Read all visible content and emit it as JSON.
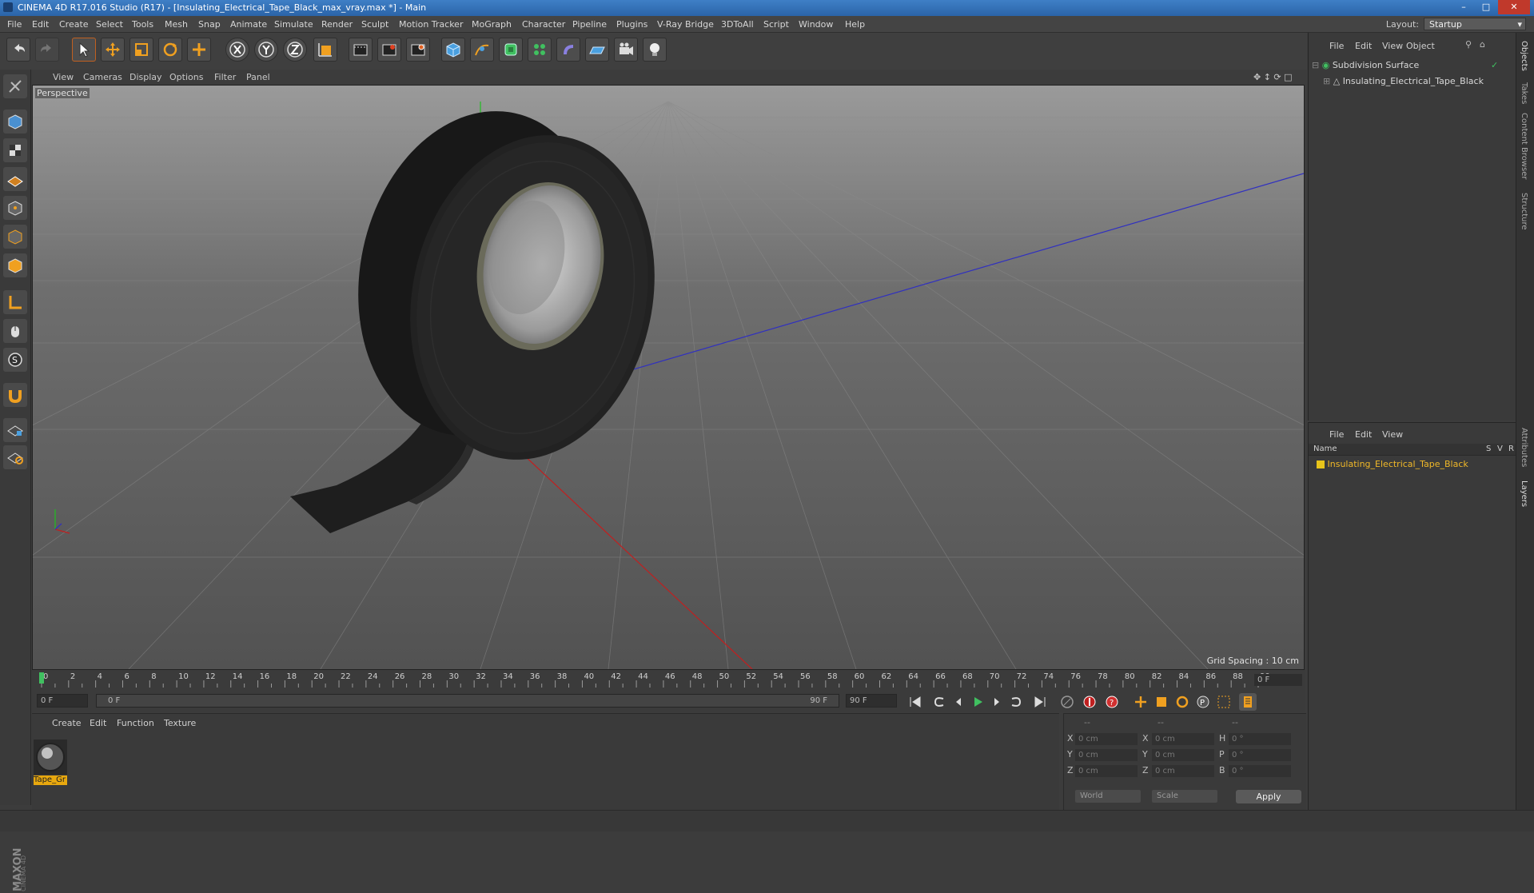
{
  "window": {
    "title": "CINEMA 4D R17.016 Studio (R17) - [Insulating_Electrical_Tape_Black_max_vray.max *] - Main"
  },
  "menu": [
    "File",
    "Edit",
    "Create",
    "Select",
    "Tools",
    "Mesh",
    "Snap",
    "Animate",
    "Simulate",
    "Render",
    "Sculpt",
    "Motion Tracker",
    "MoGraph",
    "Character",
    "Pipeline",
    "Plugins",
    "V-Ray Bridge",
    "3DToAll",
    "Script",
    "Window",
    "Help"
  ],
  "layout": {
    "label": "Layout:",
    "value": "Startup"
  },
  "toolbar": {
    "icons": [
      "undo-icon",
      "redo-icon",
      "select-arrow-icon",
      "move-icon",
      "scale-icon",
      "rotate-icon",
      "last-tool-icon",
      "x-axis-icon",
      "y-axis-icon",
      "z-axis-icon",
      "world-coord-icon",
      "render-view-icon",
      "render-picture-viewer-icon",
      "render-settings-icon",
      "cube-primitive-icon",
      "spline-pen-icon",
      "subdivision-icon",
      "mograph-cloner-icon",
      "deformer-icon",
      "floor-icon",
      "camera-icon",
      "light-icon"
    ]
  },
  "viewport": {
    "menu": [
      "View",
      "Cameras",
      "Display",
      "Options",
      "Filter",
      "Panel"
    ],
    "label": "Perspective",
    "grid_spacing": "Grid Spacing : 10 cm"
  },
  "timeline": {
    "ticks": [
      "0",
      "2",
      "4",
      "6",
      "8",
      "10",
      "12",
      "14",
      "16",
      "18",
      "20",
      "22",
      "24",
      "26",
      "28",
      "30",
      "32",
      "34",
      "36",
      "38",
      "40",
      "42",
      "44",
      "46",
      "48",
      "50",
      "52",
      "54",
      "56",
      "58",
      "60",
      "62",
      "64",
      "66",
      "68",
      "70",
      "72",
      "74",
      "76",
      "78",
      "80",
      "82",
      "84",
      "86",
      "88",
      "90"
    ],
    "current_frame": "0 F",
    "start_field": "0 F",
    "range_start": "0 F",
    "range_end": "90 F",
    "end_field": "90 F"
  },
  "material_manager": {
    "menu": [
      "Create",
      "Edit",
      "Function",
      "Texture"
    ],
    "material_name": "Tape_Gr"
  },
  "coordinates": {
    "header": [
      "--",
      "--",
      "--"
    ],
    "rows": [
      {
        "axis": "X",
        "pos": "0 cm",
        "axis2": "X",
        "size": "0 cm",
        "rot_label": "H",
        "rot": "0 °"
      },
      {
        "axis": "Y",
        "pos": "0 cm",
        "axis2": "Y",
        "size": "0 cm",
        "rot_label": "P",
        "rot": "0 °"
      },
      {
        "axis": "Z",
        "pos": "0 cm",
        "axis2": "Z",
        "size": "0 cm",
        "rot_label": "B",
        "rot": "0 °"
      }
    ],
    "mode": "World",
    "scale": "Scale",
    "apply": "Apply"
  },
  "object_manager": {
    "menu": [
      "File",
      "Edit",
      "View",
      "Object"
    ],
    "objects": [
      {
        "name": "Subdivision Surface"
      },
      {
        "name": "Insulating_Electrical_Tape_Black"
      }
    ]
  },
  "layer_manager": {
    "menu": [
      "File",
      "Edit",
      "View"
    ],
    "columns": {
      "name": "Name",
      "s": "S",
      "v": "V",
      "r": "R"
    },
    "layers": [
      {
        "name": "Insulating_Electrical_Tape_Black",
        "color": "#e8c41a"
      }
    ]
  },
  "side_tabs": [
    "Objects",
    "Takes",
    "Content Browser",
    "Structure",
    "Attributes",
    "Layers"
  ],
  "brand": "MAXON CINEMA 4D",
  "colors": {
    "accent": "#e8a80e",
    "layer_text": "#f0b828",
    "title_blue": "#2b64a8"
  }
}
